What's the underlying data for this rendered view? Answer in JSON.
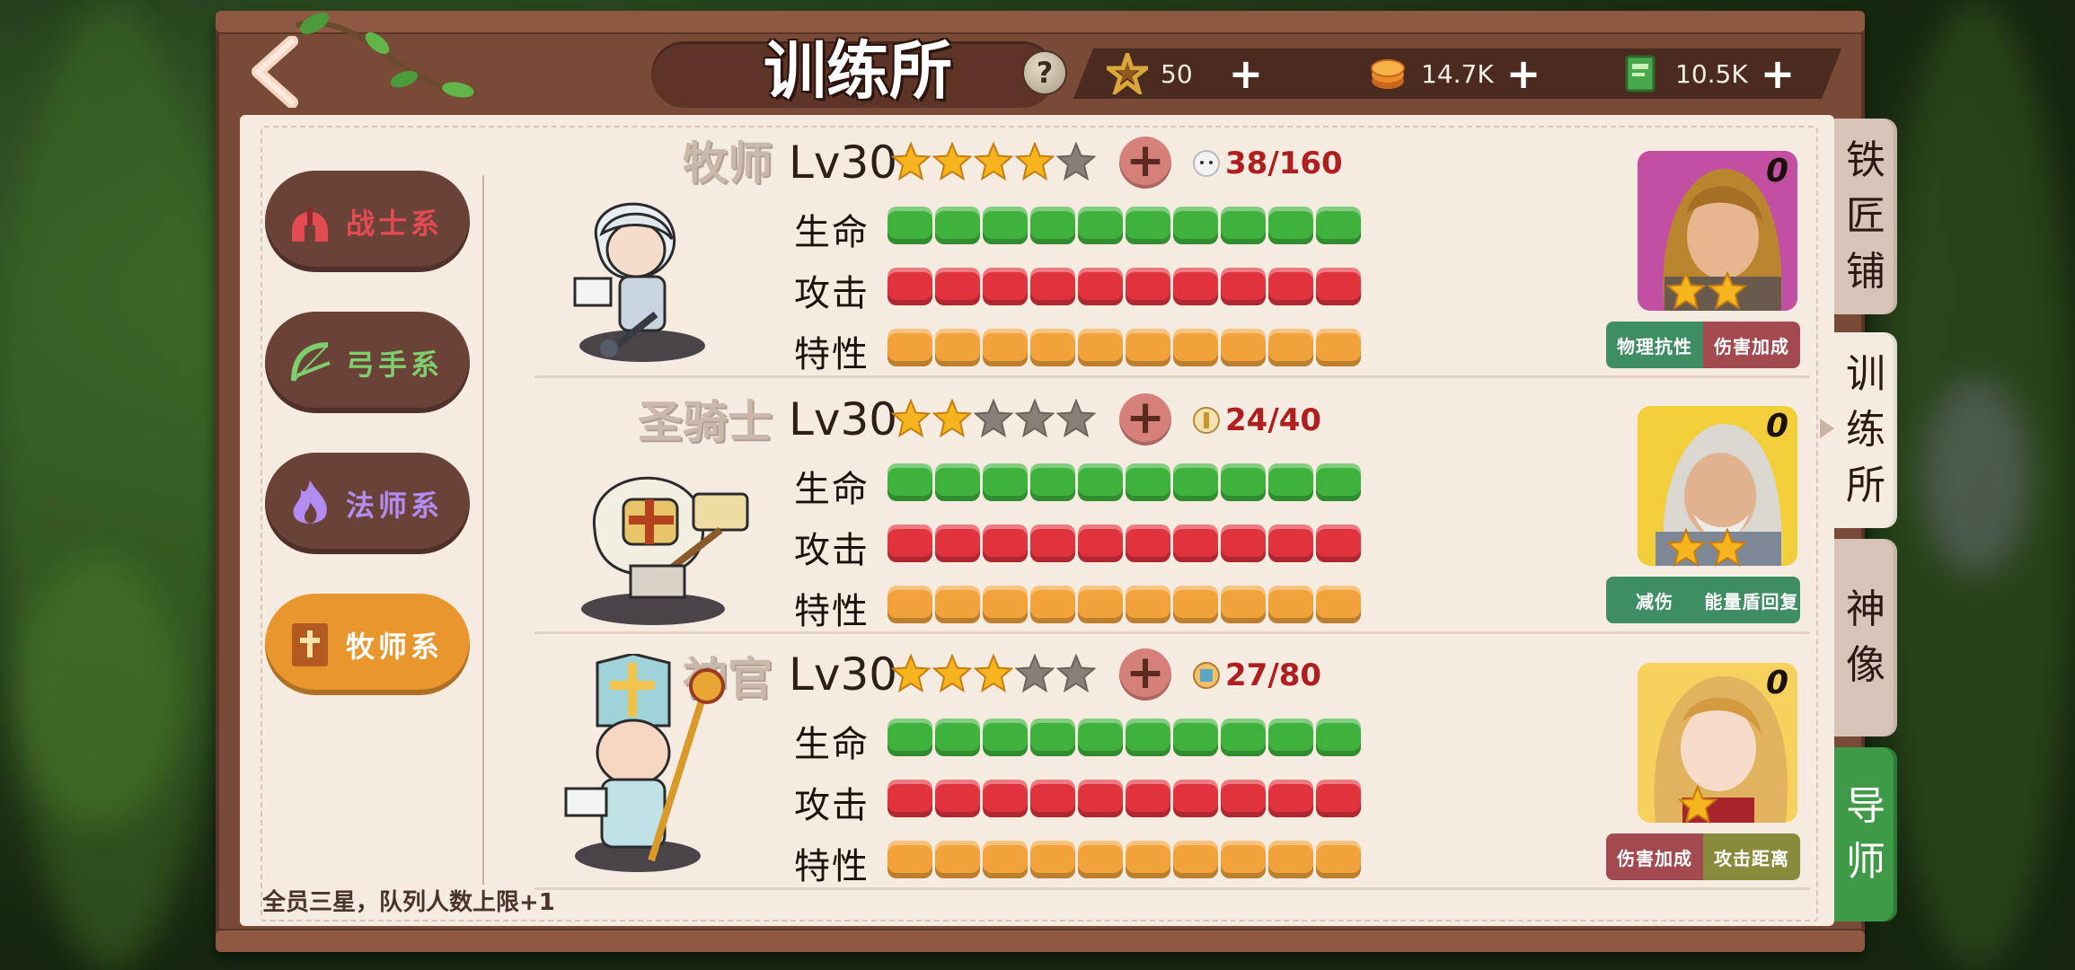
{
  "header": {
    "title": "训练所",
    "help_label": "?",
    "currencies": [
      {
        "icon": "star-fragment-icon",
        "value": "50",
        "plus": "+"
      },
      {
        "icon": "gold-coin-icon",
        "value": "14.7K",
        "plus": "+"
      },
      {
        "icon": "exp-book-icon",
        "value": "10.5K",
        "plus": "+"
      }
    ]
  },
  "categories": [
    {
      "label": "战士系",
      "icon": "helmet-icon",
      "active": false,
      "color": "#e34b52"
    },
    {
      "label": "弓手系",
      "icon": "bow-icon",
      "active": false,
      "color": "#7fcf6e"
    },
    {
      "label": "法师系",
      "icon": "flame-icon",
      "active": false,
      "color": "#b38cf2"
    },
    {
      "label": "牧师系",
      "icon": "holy-book-icon",
      "active": true,
      "color": "#ffffff"
    }
  ],
  "stat_labels": [
    "生命",
    "攻击",
    "特性"
  ],
  "heroes": [
    {
      "name": "牧师",
      "level": "Lv30",
      "stars": 4,
      "max_stars": 5,
      "shards": "38/160",
      "stats": {
        "hp": 10,
        "atk": 10,
        "trait": 10,
        "max": 10
      },
      "portrait": {
        "badge": "0",
        "stars": 2,
        "bg": "#c34fa3"
      },
      "tags": [
        {
          "label": "物理抗性",
          "color": "#3f8d63"
        },
        {
          "label": "伤害加成",
          "color": "#a24a50"
        }
      ]
    },
    {
      "name": "圣骑士",
      "level": "Lv30",
      "stars": 2,
      "max_stars": 5,
      "shards": "24/40",
      "stats": {
        "hp": 10,
        "atk": 10,
        "trait": 10,
        "max": 10
      },
      "portrait": {
        "badge": "0",
        "stars": 2,
        "bg": "#f2cf3a"
      },
      "tags": [
        {
          "label": "减伤",
          "color": "#3f8d63"
        },
        {
          "label": "能量盾回复",
          "color": "#3f8d63"
        }
      ]
    },
    {
      "name": "神官",
      "level": "Lv30",
      "stars": 3,
      "max_stars": 5,
      "shards": "27/80",
      "stats": {
        "hp": 10,
        "atk": 10,
        "trait": 10,
        "max": 10
      },
      "portrait": {
        "badge": "0",
        "stars": 1,
        "bg": "#f6d15e"
      },
      "tags": [
        {
          "label": "伤害加成",
          "color": "#a24a50"
        },
        {
          "label": "攻击距离",
          "color": "#8a8a3c"
        }
      ]
    }
  ],
  "footer_note": "全员三星，队列人数上限+1",
  "side_tabs": [
    {
      "label": [
        "铁",
        "匠",
        "铺"
      ],
      "state": "normal"
    },
    {
      "label": [
        "训",
        "练",
        "所"
      ],
      "state": "active"
    },
    {
      "label": [
        "神",
        "像"
      ],
      "state": "normal"
    },
    {
      "label": [
        "导",
        "师"
      ],
      "state": "green"
    }
  ],
  "colors": {
    "hp": "#3fb23d",
    "atk": "#e0333e",
    "trait": "#f2a23a"
  }
}
